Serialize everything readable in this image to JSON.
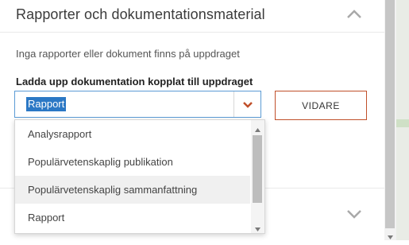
{
  "section": {
    "title": "Rapporter och dokumentationsmaterial",
    "info": "Inga rapporter eller dokument finns på uppdraget",
    "upload_label": "Ladda upp dokumentation kopplat till uppdraget"
  },
  "select": {
    "selected": "Rapport",
    "options": [
      "Analysrapport",
      "Populärvetenskaplig publikation",
      "Populärvetenskaplig sammanfattning",
      "Rapport"
    ],
    "hovered_index": 2
  },
  "buttons": {
    "next": "VIDARE"
  },
  "colors": {
    "accent": "#c0502a",
    "select_border": "#5b9bd5",
    "selection": "#2b78c5"
  },
  "icons": [
    "chevron-up-icon",
    "chevron-down-icon",
    "caret-down-icon"
  ]
}
